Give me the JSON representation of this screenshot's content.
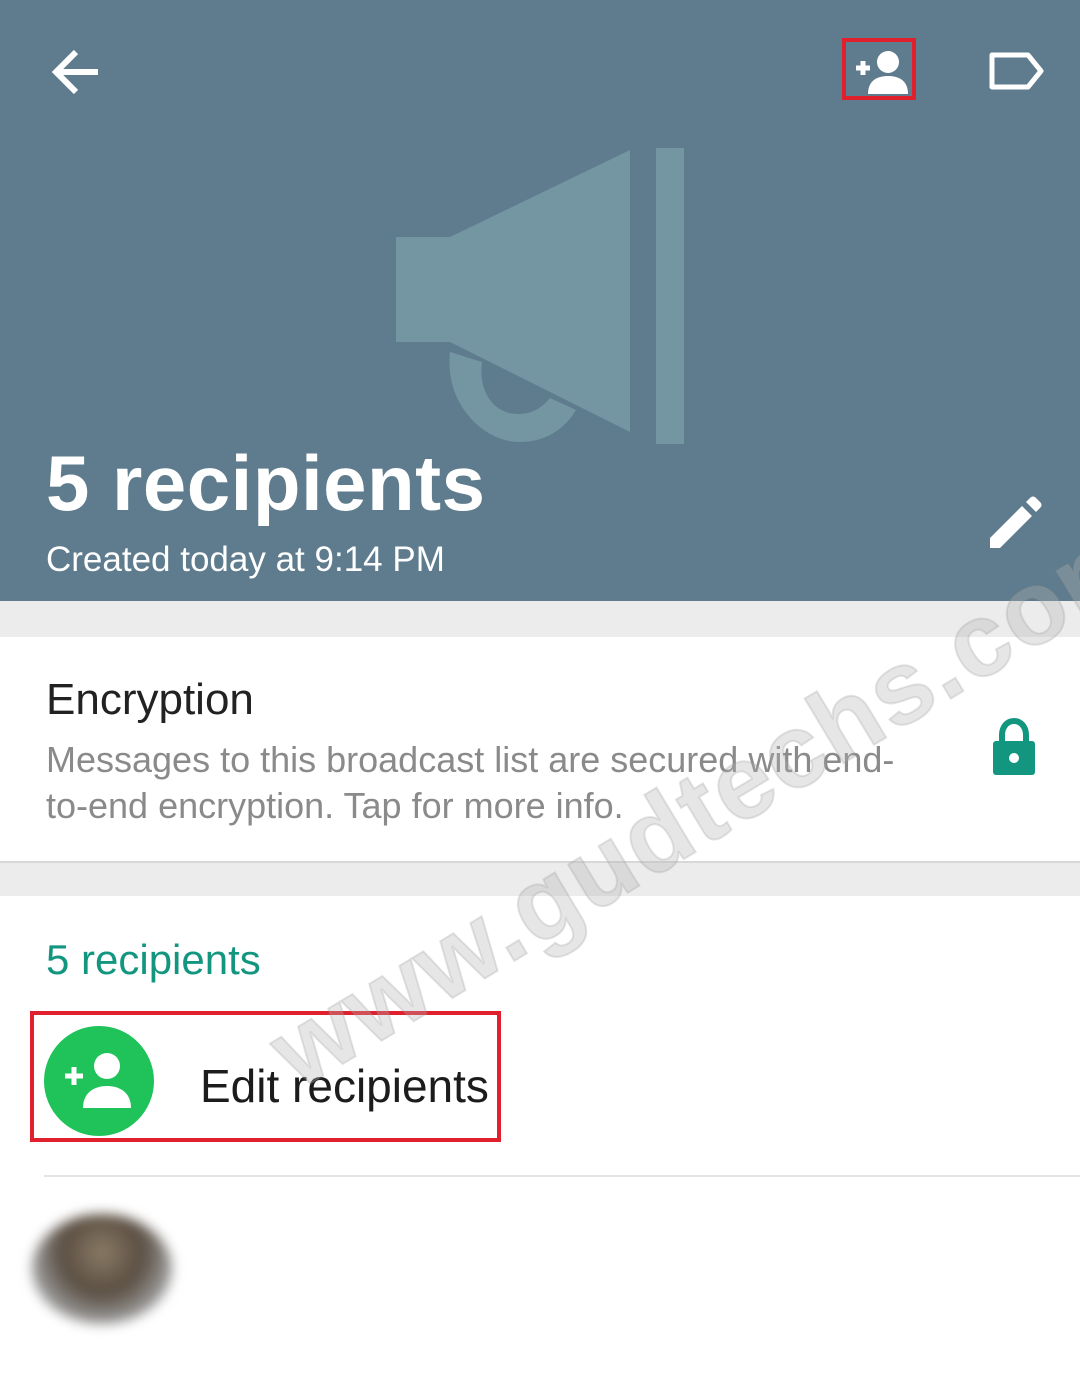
{
  "header": {
    "title": "5 recipients",
    "subtitle": "Created today at 9:14 PM",
    "back_icon": "arrow-back-icon",
    "add_recipient_icon": "person-add-icon",
    "label_icon": "label-tag-icon",
    "edit_icon": "pencil-icon",
    "background_icon": "megaphone-icon",
    "background_color": "#5e7c8d"
  },
  "encryption": {
    "title": "Encryption",
    "description": "Messages to this broadcast list are secured with end-to-end encryption. Tap for more info.",
    "icon": "lock-icon",
    "icon_color": "#12967f"
  },
  "recipients": {
    "count_label": "5 recipients",
    "edit_label": "Edit recipients",
    "edit_icon": "person-add-icon",
    "edit_icon_bg": "#1fc35a",
    "accent_color": "#12967f"
  },
  "contact": {
    "name": "",
    "status": ""
  },
  "watermark": {
    "text": "www.gudtechs.com"
  },
  "highlight_color": "#e0202c"
}
